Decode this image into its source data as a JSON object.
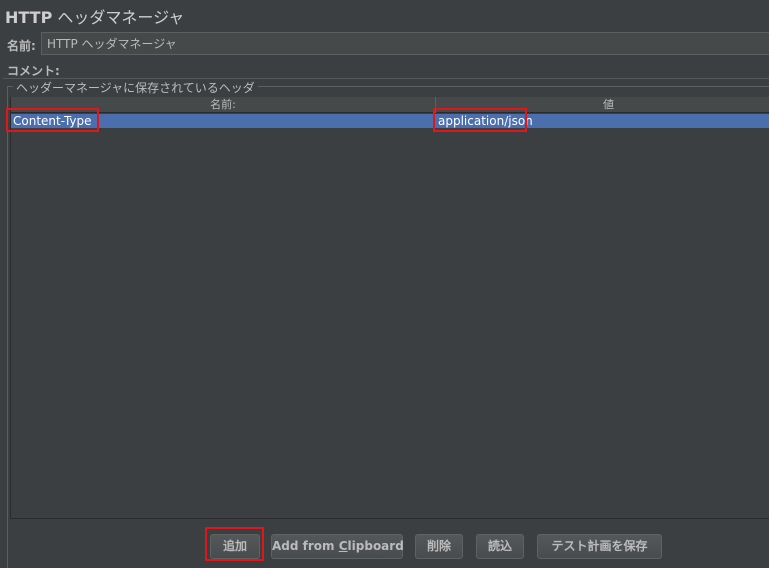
{
  "window": {
    "title_bold": "HTTP",
    "title_rest": " ヘッダマネージャ"
  },
  "form": {
    "name_label": "名前:",
    "name_value": "HTTP ヘッダマネージャ",
    "comment_label": "コメント:"
  },
  "group": {
    "title": "ヘッダーマネージャに保存されているヘッダ"
  },
  "table": {
    "columns": [
      "名前:",
      "値"
    ],
    "rows": [
      {
        "name": "Content-Type",
        "value": "application/json",
        "selected": true
      }
    ]
  },
  "buttons": {
    "add": "追加",
    "clip_prefix": "Add from ",
    "clip_mnemonic": "C",
    "clip_suffix": "lipboard",
    "delete": "削除",
    "load": "読込",
    "save": "テスト計画を保存"
  },
  "colors": {
    "background": "#3c3f41",
    "selection": "#4b6eaf",
    "highlight": "#e0161b"
  }
}
